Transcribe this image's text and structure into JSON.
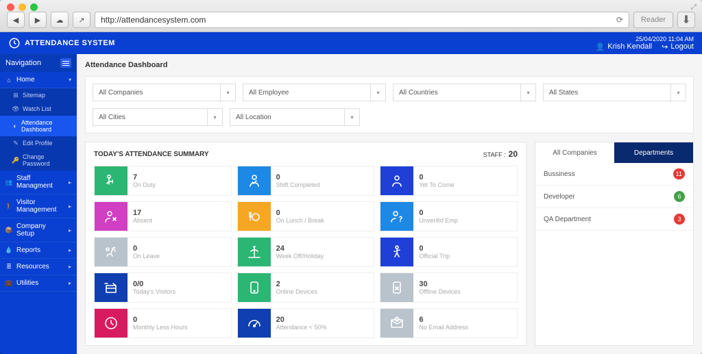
{
  "browser": {
    "url": "http://attendancesystem.com",
    "reader": "Reader"
  },
  "header": {
    "app_name": "ATTENDANCE SYSTEM",
    "datetime": "25/04/2020 11:04 AM",
    "user": "Krish Kendall",
    "logout": "Logout"
  },
  "sidebar": {
    "nav_label": "Navigation",
    "home": "Home",
    "sub": [
      {
        "label": "Sitemap",
        "icon": "sitemap"
      },
      {
        "label": "Watch List",
        "icon": "eye"
      },
      {
        "label": "Attendance Dashboard",
        "icon": "gauge",
        "active": true
      },
      {
        "label": "Edit Profile",
        "icon": "user"
      },
      {
        "label": "Change Password",
        "icon": "key"
      }
    ],
    "items": [
      {
        "label": "Staff Managment",
        "icon": "users"
      },
      {
        "label": "Visitor Management",
        "icon": "walk"
      },
      {
        "label": "Company Setup",
        "icon": "package"
      },
      {
        "label": "Reports",
        "icon": "drop"
      },
      {
        "label": "Resources",
        "icon": "db"
      },
      {
        "label": "Utilities",
        "icon": "briefcase"
      }
    ]
  },
  "page": {
    "title": "Attendance Dashboard",
    "filters": [
      "All Companies",
      "All Employee",
      "All Countries",
      "All States",
      "All Cities",
      "All Location"
    ],
    "summary_title": "TODAY'S ATTENDANCE SUMMARY",
    "staff_label": "STAFF :",
    "staff_count": "20",
    "cards": [
      {
        "value": "7",
        "label": "On Duty",
        "color": "#2cb673",
        "icon": "onduty"
      },
      {
        "value": "0",
        "label": "Shift Completed",
        "color": "#1e88e5",
        "icon": "shiftdone"
      },
      {
        "value": "0",
        "label": "Yet To Come",
        "color": "#1f3fd6",
        "icon": "yetcome"
      },
      {
        "value": "17",
        "label": "Absent",
        "color": "#d13fc2",
        "icon": "absent"
      },
      {
        "value": "0",
        "label": "On Lunch / Break",
        "color": "#f5a623",
        "icon": "lunch"
      },
      {
        "value": "0",
        "label": "Unverifid Emp",
        "color": "#1e88e5",
        "icon": "unverified"
      },
      {
        "value": "0",
        "label": "On Leave",
        "color": "#b9c3cc",
        "icon": "leave"
      },
      {
        "value": "24",
        "label": "Week Off/Holiday",
        "color": "#2cb673",
        "icon": "holiday"
      },
      {
        "value": "0",
        "label": "Official Trip",
        "color": "#1f3fd6",
        "icon": "trip"
      },
      {
        "value": "0/0",
        "label": "Today's Visitors",
        "color": "#0f3fb0",
        "icon": "visitors"
      },
      {
        "value": "2",
        "label": "Online Devices",
        "color": "#2cb673",
        "icon": "online"
      },
      {
        "value": "30",
        "label": "Offline Devices",
        "color": "#b9c3cc",
        "icon": "offline"
      },
      {
        "value": "0",
        "label": "Monthly Less Hours",
        "color": "#d81b60",
        "icon": "clock"
      },
      {
        "value": "20",
        "label": "Attendance < 50%",
        "color": "#0f3fb0",
        "icon": "gauge"
      },
      {
        "value": "6",
        "label": "No Email Address",
        "color": "#b9c3cc",
        "icon": "noemail"
      }
    ]
  },
  "dept": {
    "tabs": [
      "All Companies",
      "Departments"
    ],
    "active_tab": 1,
    "rows": [
      {
        "name": "Bussiness",
        "count": "11",
        "color": "red"
      },
      {
        "name": "Developer",
        "count": "6",
        "color": "green"
      },
      {
        "name": "QA Department",
        "count": "3",
        "color": "red"
      }
    ]
  }
}
